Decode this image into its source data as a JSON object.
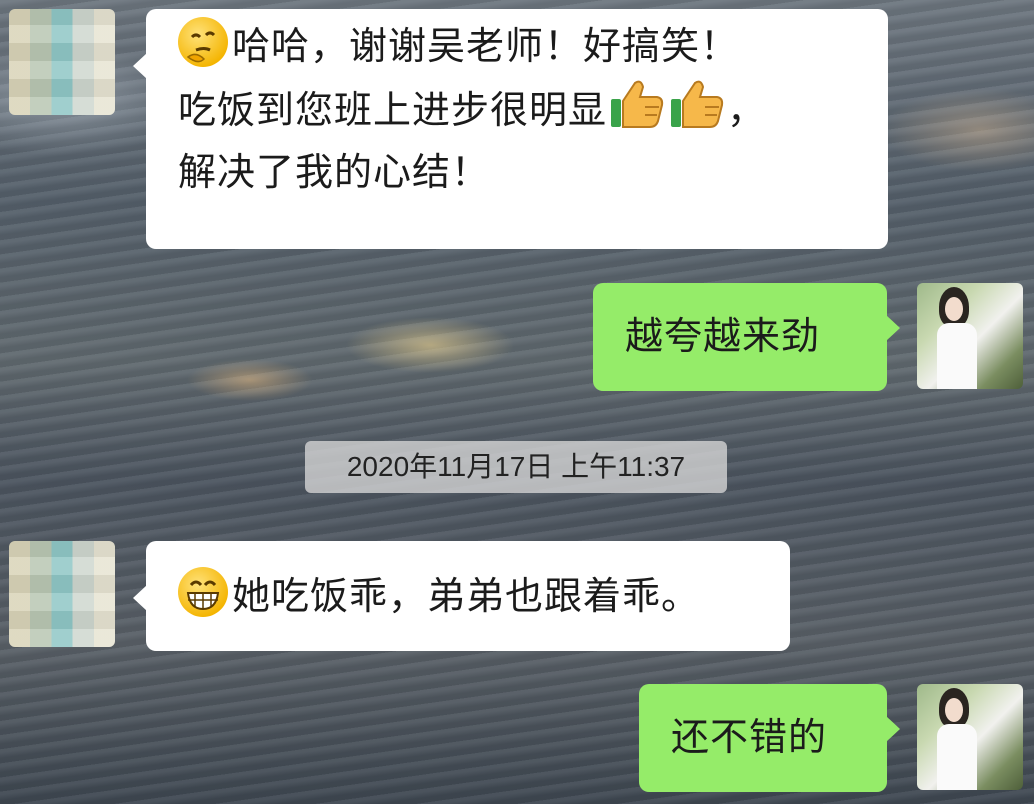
{
  "messages": [
    {
      "side": "left",
      "lines": [
        "哈哈，谢谢吴老师！好搞笑！",
        "吃饭到您班上进步很明显",
        "，",
        "解决了我的心结！"
      ],
      "emoji_lead": "thinking-face-emoji",
      "emoji_inline": [
        "thumbs-up-emoji",
        "thumbs-up-emoji"
      ]
    },
    {
      "side": "right",
      "text": "越夸越来劲"
    },
    {
      "side": "left",
      "text": "她吃饭乖，弟弟也跟着乖。",
      "emoji_lead": "grinning-face-emoji"
    },
    {
      "side": "right",
      "text": "还不错的"
    }
  ],
  "timestamp": "2020年11月17日 上午11:37",
  "colors": {
    "bubble_self": "#95ec69",
    "bubble_other": "#ffffff",
    "timestamp_bg": "#d7d7d7"
  }
}
